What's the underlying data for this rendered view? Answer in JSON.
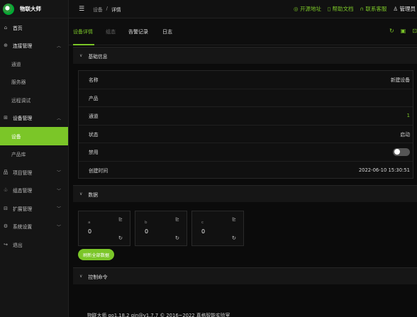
{
  "app": {
    "title": "物联大师"
  },
  "sidebar": {
    "items": [
      {
        "label": "首页",
        "icon": "home-icon"
      },
      {
        "label": "连接管理",
        "icon": "link-icon"
      },
      {
        "label": "通道"
      },
      {
        "label": "服务器"
      },
      {
        "label": "远程调试"
      },
      {
        "label": "设备管理",
        "icon": "grid-icon"
      },
      {
        "label": "设备"
      },
      {
        "label": "产品库"
      },
      {
        "label": "项目管理",
        "icon": "project-icon"
      },
      {
        "label": "组态管理",
        "icon": "graph-icon"
      },
      {
        "label": "扩展管理",
        "icon": "table-icon"
      },
      {
        "label": "系统设置",
        "icon": "gear-icon"
      },
      {
        "label": "退出",
        "icon": "exit-icon"
      }
    ]
  },
  "header": {
    "breadcrumb": [
      "设备",
      "/",
      "详情"
    ],
    "links": {
      "opensource": "开源地址",
      "docs": "帮助文档",
      "support": "联系客服",
      "admin": "管理员"
    }
  },
  "tabs": [
    "设备详情",
    "组态",
    "告警记录",
    "日志"
  ],
  "sections": {
    "basic": "基础信息",
    "data": "数据",
    "control": "控制命令"
  },
  "details": [
    {
      "key": "名称",
      "value": "新建设备"
    },
    {
      "key": "产品",
      "value": ""
    },
    {
      "key": "通道",
      "value": "1"
    },
    {
      "key": "状态",
      "value": "启动"
    },
    {
      "key": "禁用",
      "value": ""
    },
    {
      "key": "创建时间",
      "value": "2022-06-10 15:30:51"
    }
  ],
  "points": [
    {
      "name": "a",
      "value": "0"
    },
    {
      "name": "b",
      "value": "0"
    },
    {
      "name": "c",
      "value": "0"
    }
  ],
  "buttons": {
    "refresh_all": "刷新全部数据"
  },
  "footer": "物联大师 go1.18.2 gin@v1.7.7 © 2016~2022 真格智能实验室",
  "colors": {
    "accent": "#7bc628",
    "sidebar_bg": "#151515"
  }
}
